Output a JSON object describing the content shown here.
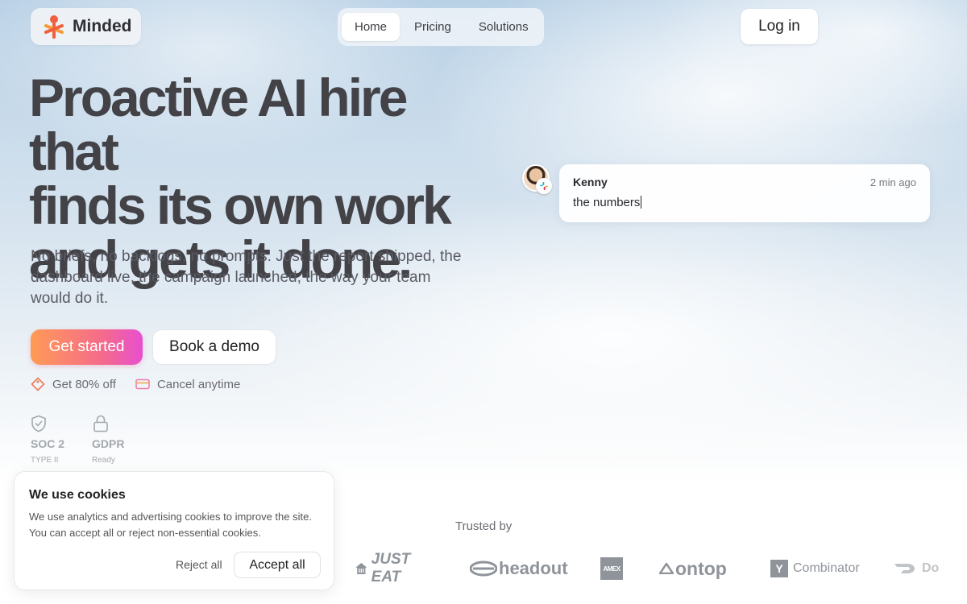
{
  "brand": {
    "name": "Minded"
  },
  "nav": {
    "items": [
      {
        "label": "Home"
      },
      {
        "label": "Pricing"
      },
      {
        "label": "Solutions"
      }
    ]
  },
  "header": {
    "login_label": "Log in"
  },
  "hero": {
    "headline_lines": [
      "Proactive AI hire that",
      "finds its own work",
      "and gets it done."
    ],
    "subtext": "No briefs, no backlogs, no prompts. Just the report shipped, the dashboard live, the campaign launched, the way your team would do it.",
    "primary_cta": "Get started",
    "secondary_cta": "Book a demo",
    "perks": [
      {
        "label": "Get 80% off",
        "icon": "coupon-icon"
      },
      {
        "label": "Cancel anytime",
        "icon": "credit-card-icon"
      }
    ],
    "badges": [
      {
        "title": "SOC 2",
        "sub": "TYPE II",
        "icon": "shield-check-icon"
      },
      {
        "title": "GDPR",
        "sub": "Ready",
        "icon": "lock-icon"
      }
    ]
  },
  "chat": {
    "name": "Kenny",
    "time": "2 min ago",
    "message": "the numbers"
  },
  "trusted": {
    "label": "Trusted by",
    "logos": [
      "JUST EAT",
      "headout",
      "AMEX",
      "ontop",
      "Combinator",
      "Do"
    ]
  },
  "cookie": {
    "title": "We use cookies",
    "text": "We use analytics and advertising cookies to improve the site. You can accept all or reject non-essential cookies.",
    "reject_label": "Reject all",
    "accept_label": "Accept all"
  },
  "colors": {
    "accent_start": "#ff9b55",
    "accent_end": "#e84fd0",
    "text_dark": "#424247"
  }
}
